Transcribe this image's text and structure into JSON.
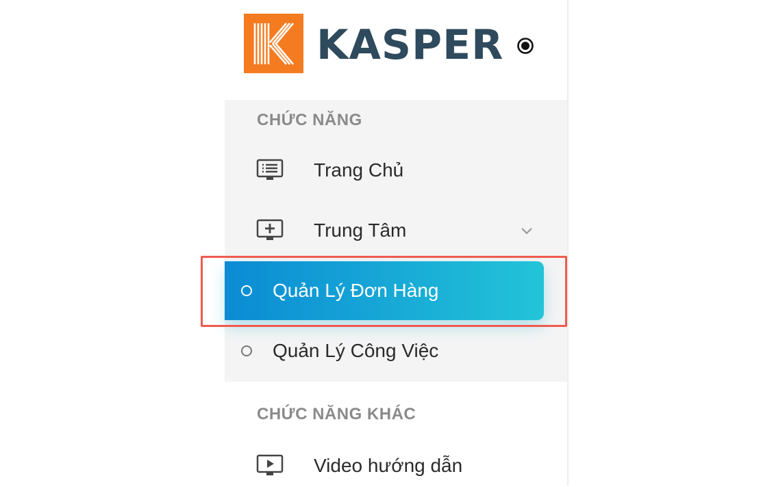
{
  "brand": {
    "name": "KASPER",
    "logo_color": "#f47b20",
    "text_color": "#2e4a5c"
  },
  "header": {
    "pin_icon": "radio-dot-icon"
  },
  "sections": [
    {
      "title": "CHỨC NĂNG",
      "items": [
        {
          "label": "Trang Chủ",
          "icon": "list-monitor-icon"
        },
        {
          "label": "Trung Tâm",
          "icon": "add-monitor-icon",
          "expanded": true,
          "children": [
            {
              "label": "Quản Lý Đơn Hàng",
              "active": true
            },
            {
              "label": "Quản Lý Công Việc",
              "active": false
            }
          ]
        }
      ]
    },
    {
      "title": "CHỨC NĂNG KHÁC",
      "items": [
        {
          "label": "Video hướng dẫn",
          "icon": "play-monitor-icon"
        }
      ]
    }
  ],
  "colors": {
    "active_gradient_start": "#0b8bd4",
    "active_gradient_end": "#23c4d8",
    "highlight_border": "#ef5a4e"
  }
}
